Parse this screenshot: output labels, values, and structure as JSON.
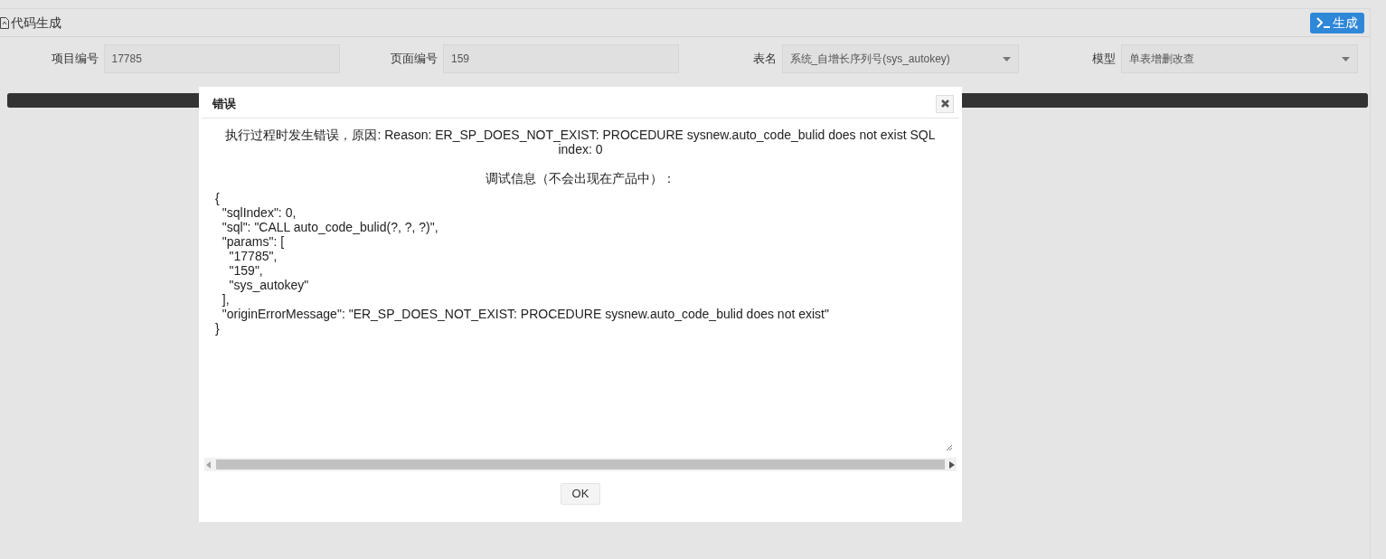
{
  "panel": {
    "title": "代码生成",
    "generate_button": "生成"
  },
  "progress": {
    "level": 1
  },
  "form": {
    "fields": [
      {
        "kind": "text",
        "label": "项目编号",
        "value": "17785"
      },
      {
        "kind": "text",
        "label": "页面编号",
        "value": "159"
      },
      {
        "kind": "select",
        "label": "表名",
        "value": "系统_自增长序列号(sys_autokey)"
      },
      {
        "kind": "select",
        "label": "模型",
        "value": "单表增删改查"
      }
    ]
  },
  "dialog": {
    "title": "错误",
    "message": "执行过程时发生错误，原因: Reason: ER_SP_DOES_NOT_EXIST: PROCEDURE sysnew.auto_code_bulid does not exist SQL index: 0",
    "debug_label": "调试信息（不会出现在产品中）：",
    "debug_text": "{\n  \"sqlIndex\": 0,\n  \"sql\": \"CALL auto_code_bulid(?, ?, ?)\",\n  \"params\": [\n    \"17785\",\n    \"159\",\n    \"sys_autokey\"\n  ],\n  \"originErrorMessage\": \"ER_SP_DOES_NOT_EXIST: PROCEDURE sysnew.auto_code_bulid does not exist\"\n}",
    "ok_button": "OK"
  }
}
